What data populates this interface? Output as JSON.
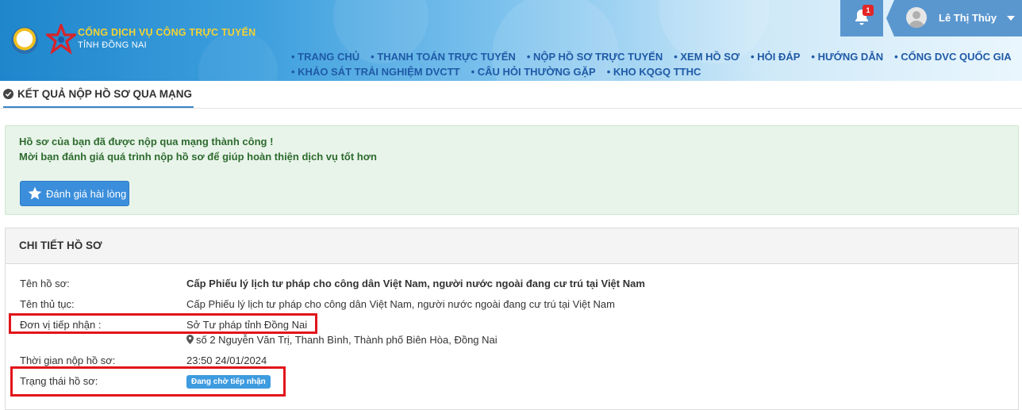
{
  "header": {
    "site_title": "CỔNG DỊCH VỤ CÔNG TRỰC TUYẾN",
    "site_subtitle": "TỈNH ĐỒNG NAI",
    "nav_row1": [
      "TRANG CHỦ",
      "THANH TOÁN TRỰC TUYẾN",
      "NỘP HỒ SƠ TRỰC TUYẾN",
      "XEM HỒ SƠ",
      "HỎI ĐÁP",
      "HƯỚNG DẪN",
      "CỔNG DVC QUỐC GIA"
    ],
    "nav_row2": [
      "KHẢO SÁT TRẢI NGHIỆM DVCTT",
      "CÂU HỎI THƯỜNG GẶP",
      "KHO KQGQ TTHC"
    ],
    "notification_count": "1",
    "user_name": "Lê Thị Thủy",
    "colors": {
      "header_accent": "#5b97cf",
      "nav_text": "#1f5aa6",
      "title_gold": "#f3d335"
    }
  },
  "page": {
    "title": "KẾT QUẢ NỘP HỒ SƠ QUA MẠNG"
  },
  "success": {
    "line1": "Hồ sơ của bạn đã được nộp qua mạng thành công !",
    "line2": "Mời bạn đánh giá quá trình nộp hồ sơ để giúp hoàn thiện dịch vụ tốt hơn",
    "rate_button": "Đánh giá hài lòng"
  },
  "detail": {
    "panel_title": "CHI TIẾT HỒ SƠ",
    "rows": {
      "ho_so_label": "Tên hồ sơ:",
      "ho_so_value": "Cấp Phiếu lý lịch tư pháp cho công dân Việt Nam, người nước ngoài đang cư trú tại Việt Nam",
      "thu_tuc_label": "Tên thủ tục:",
      "thu_tuc_value": "Cấp Phiếu lý lịch tư pháp cho công dân Việt Nam, người nước ngoài đang cư trú tại Việt Nam",
      "don_vi_label": "Đơn vị tiếp nhận :",
      "don_vi_value": "Sở Tư pháp tỉnh Đồng Nai",
      "address": "số 2 Nguyễn Văn Trị, Thanh Bình, Thành phố Biên Hòa, Đồng Nai",
      "thoi_gian_label": "Thời gian nộp hồ sơ:",
      "thoi_gian_value": "23:50 24/01/2024",
      "trang_thai_label": "Trạng thái hồ sơ:",
      "trang_thai_value": "Đang chờ tiếp nhận"
    }
  }
}
